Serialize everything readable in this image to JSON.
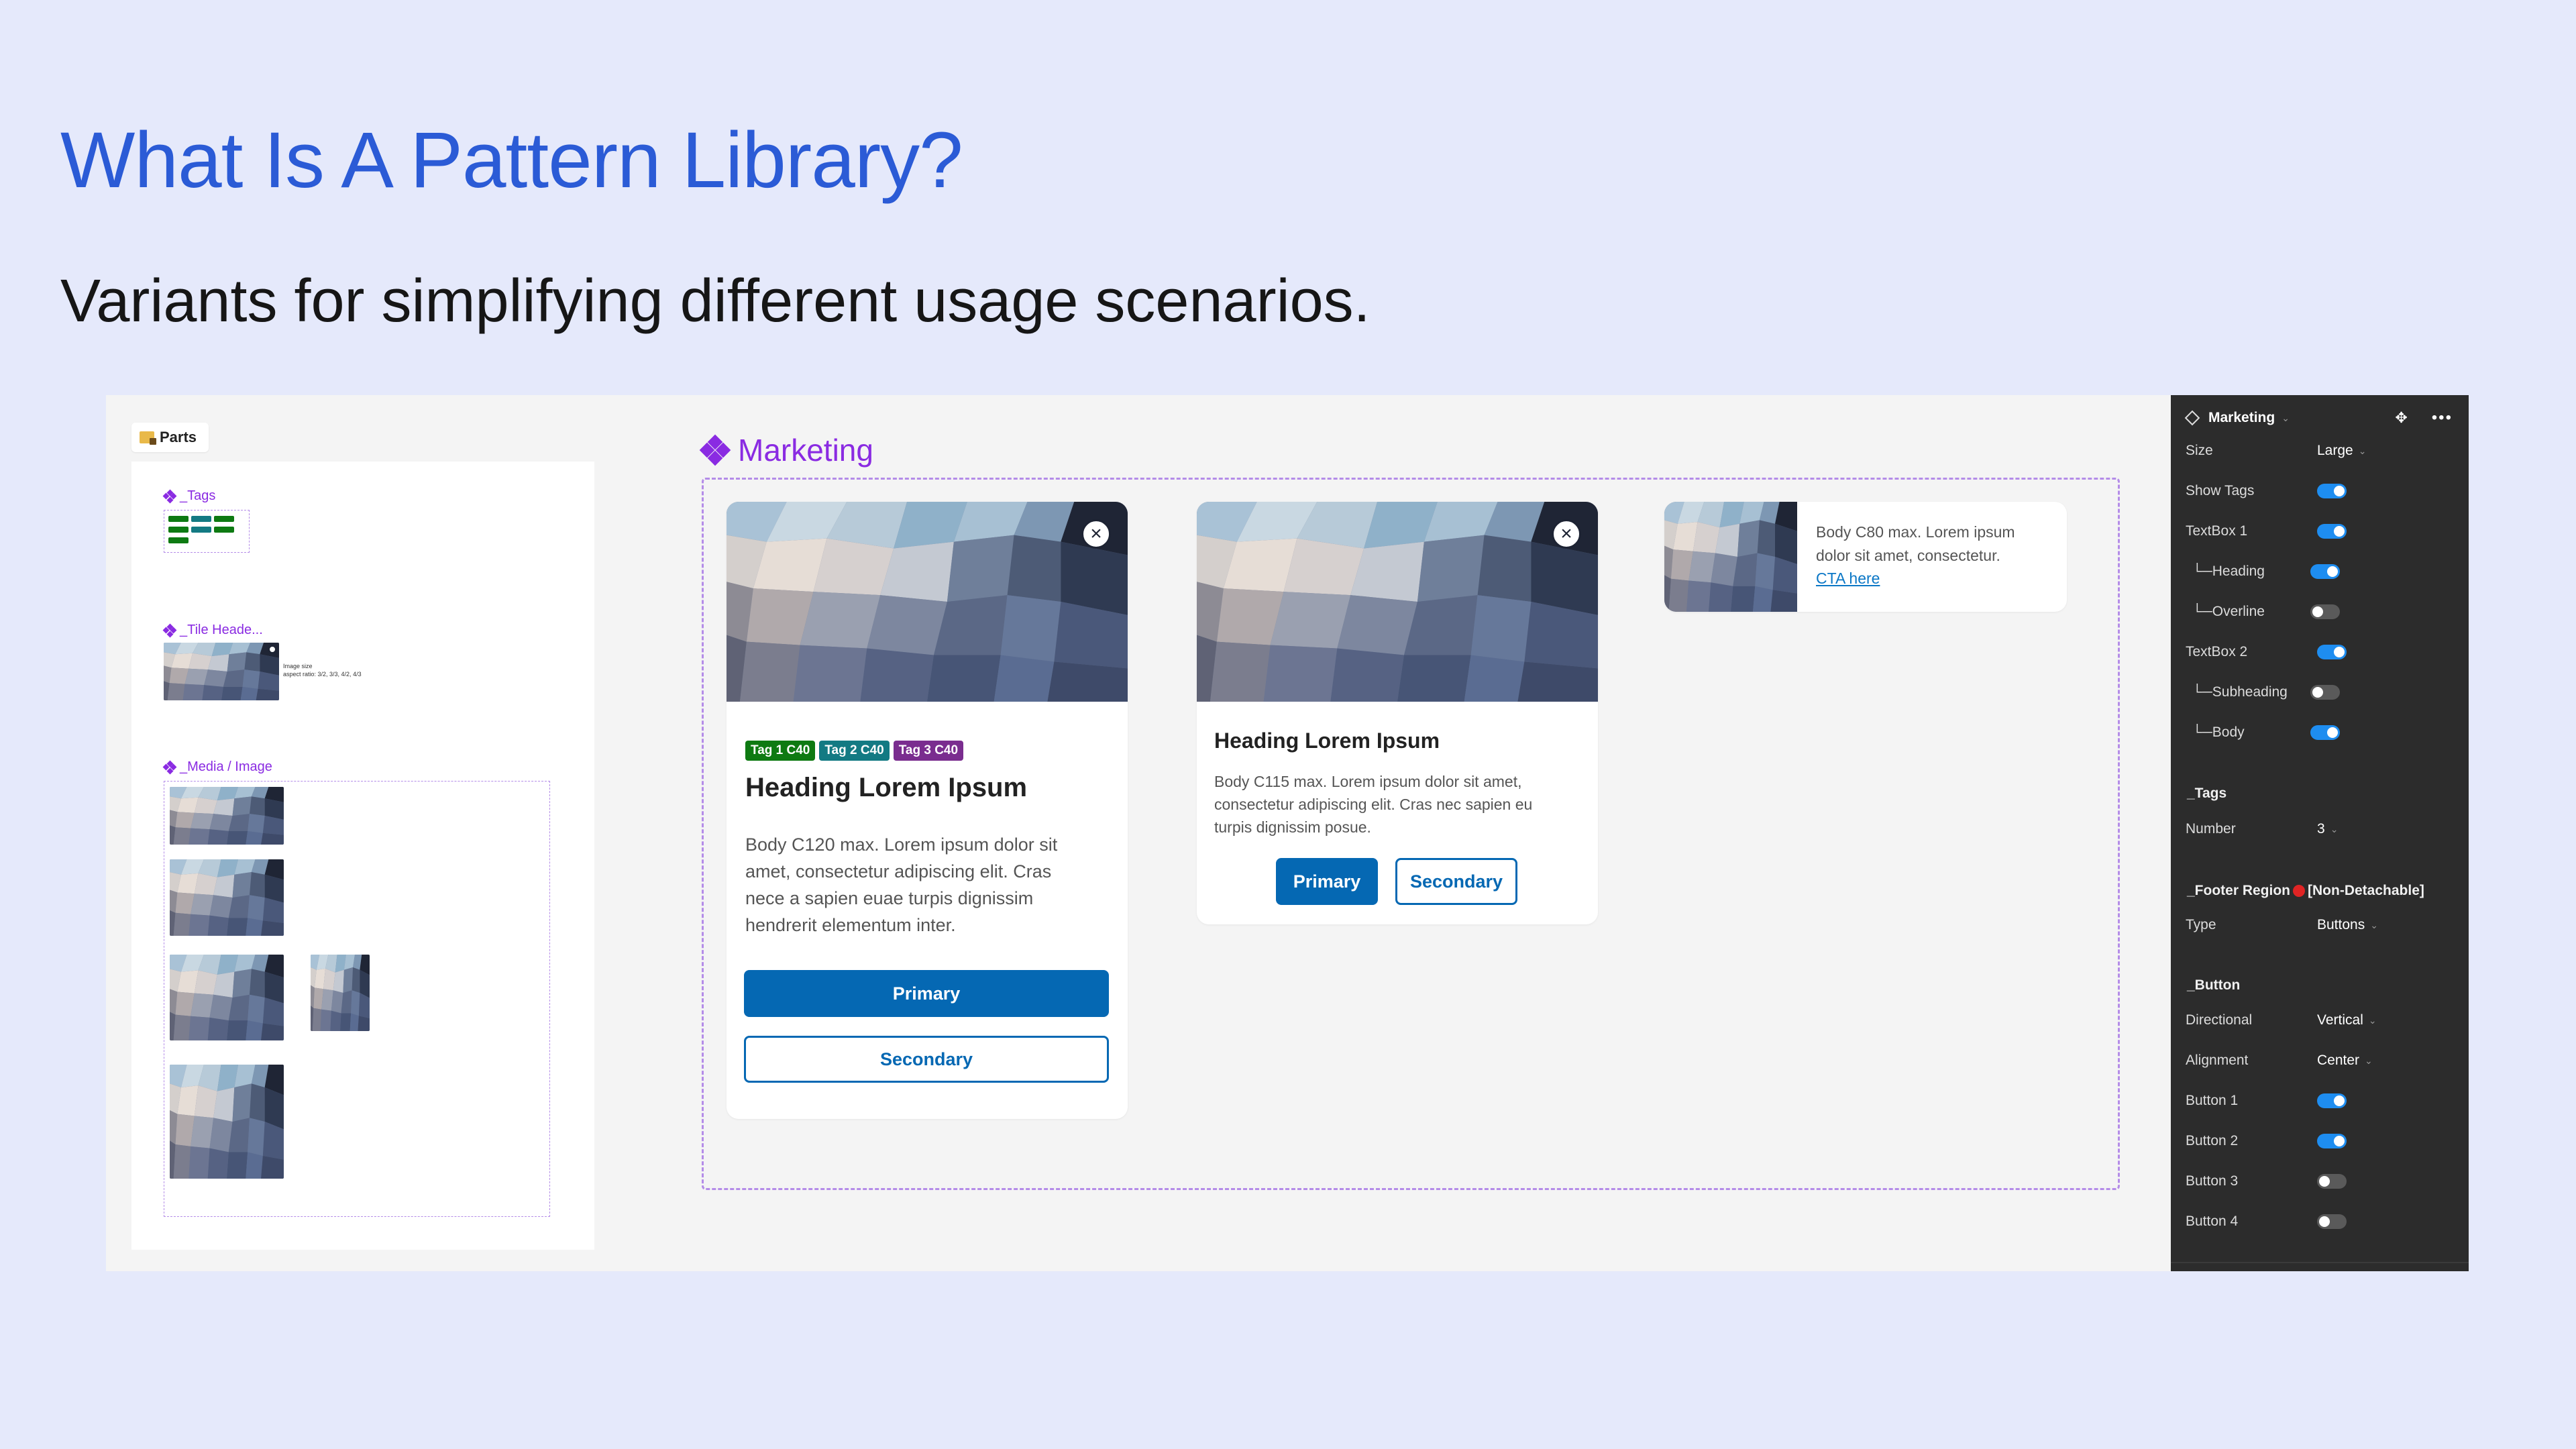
{
  "slide": {
    "title": "What Is A Pattern Library?",
    "subtitle": "Variants for simplifying different usage scenarios."
  },
  "parts": {
    "chip_label": "Parts",
    "tags_label": "_Tags",
    "tile_header_label": "_Tile Heade...",
    "tile_note_line1": "Image size",
    "tile_note_line2": "aspect ratio: 3/2, 3/3, 4/2, 4/3",
    "media_label": "_Media / Image"
  },
  "marketing": {
    "label": "Marketing",
    "card_large": {
      "tags": [
        "Tag 1 C40",
        "Tag 2 C40",
        "Tag 3 C40"
      ],
      "heading": "Heading Lorem Ipsum",
      "body_lines": [
        "Body C120 max. Lorem ipsum dolor sit",
        "amet,  consectetur adipiscing elit. Cras",
        "nece a sapien euae turpis dignissim",
        "hendrerit elementum inter."
      ],
      "primary": "Primary",
      "secondary": "Secondary"
    },
    "card_medium": {
      "heading": "Heading Lorem Ipsum",
      "body_lines": [
        "Body C115 max. Lorem ipsum dolor sit amet,",
        "consectetur adipiscing elit. Cras nec sapien eu",
        "turpis dignissim posue."
      ],
      "primary": "Primary",
      "secondary": "Secondary"
    },
    "card_small": {
      "body_line1": "Body C80 max. Lorem ipsum",
      "body_line2": "dolor sit amet, consectetur.",
      "cta": "CTA here"
    }
  },
  "panel": {
    "component": "Marketing",
    "rows": {
      "size": {
        "label": "Size",
        "value": "Large"
      },
      "show_tags": {
        "label": "Show Tags",
        "on": true
      },
      "textbox1": {
        "label": "TextBox 1",
        "on": true
      },
      "heading": {
        "label": "└─Heading",
        "on": true
      },
      "overline": {
        "label": "└─Overline",
        "on": false
      },
      "textbox2": {
        "label": "TextBox 2",
        "on": true
      },
      "subheading": {
        "label": "└─Subheading",
        "on": false
      },
      "body": {
        "label": "└─Body",
        "on": true
      }
    },
    "tags_section": "_Tags",
    "number": {
      "label": "Number",
      "value": "3"
    },
    "footer_section": "_Footer Region",
    "footer_suffix": "[Non-Detachable]",
    "type": {
      "label": "Type",
      "value": "Buttons"
    },
    "button_section": "_Button",
    "directional": {
      "label": "Directional",
      "value": "Vertical"
    },
    "alignment": {
      "label": "Alignment",
      "value": "Center"
    },
    "button1": {
      "label": "Button 1",
      "on": true
    },
    "button2": {
      "label": "Button 2",
      "on": true
    },
    "button3": {
      "label": "Button 3",
      "on": false
    },
    "button4": {
      "label": "Button 4",
      "on": false
    }
  },
  "colors": {
    "slide_bg": "#e5e9fb",
    "title": "#2b5bd6",
    "purple": "#8a2be2",
    "primary_blue": "#0568b3",
    "tag_green": "#0e7a12",
    "tag_teal": "#137a83",
    "tag_purple": "#7a2d8f",
    "toggle_on": "#1e8df0"
  }
}
